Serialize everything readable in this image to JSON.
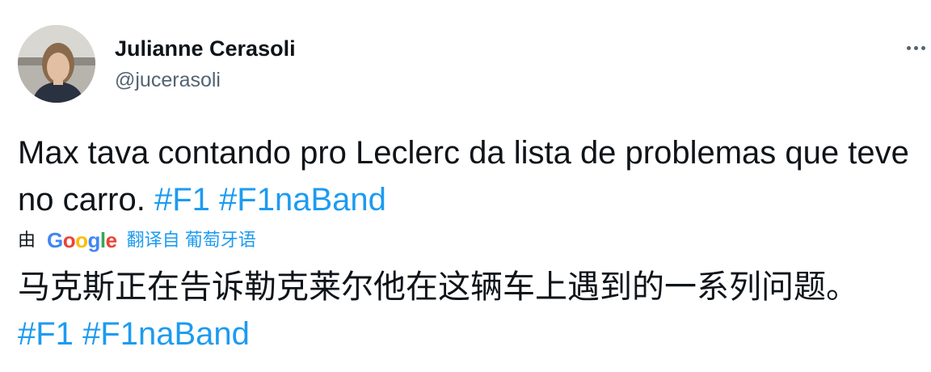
{
  "author": {
    "name": "Julianne Cerasoli",
    "handle": "@jucerasoli"
  },
  "tweet": {
    "text": "Max tava contando pro Leclerc da lista de problemas que teve no carro.",
    "hashtags": [
      "#F1",
      "#F1naBand"
    ]
  },
  "translation": {
    "by_label": "由",
    "provider": "Google",
    "link_text": "翻译自 葡萄牙语",
    "text": "马克斯正在告诉勒克莱尔他在这辆车上遇到的一系列问题。",
    "hashtags": [
      "#F1",
      "#F1naBand"
    ]
  },
  "icons": {
    "more": "more-horizontal-icon",
    "avatar": "profile-photo"
  },
  "colors": {
    "link": "#1d9bf0",
    "secondary_text": "#536471",
    "primary_text": "#0f1419"
  }
}
